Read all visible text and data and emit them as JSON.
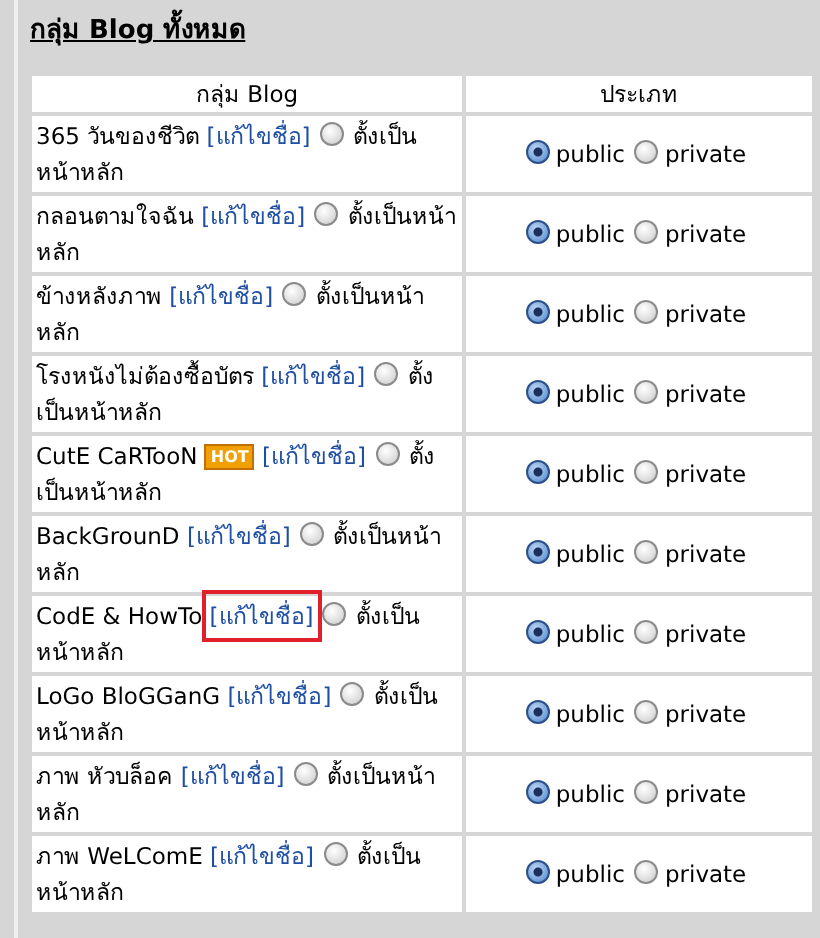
{
  "title": "กลุ่ม Blog ทั้งหมด",
  "table": {
    "columns": [
      "กลุ่ม Blog",
      "ประเภท"
    ],
    "rows": [
      {
        "name": "365 วันของชีวิต",
        "edit_link": "[แก้ไขชื่อ]",
        "highlighted": false,
        "set_main": {
          "label": "ตั้งเป็นหน้าหลัก",
          "checked": false
        },
        "visibility": [
          {
            "label": "public",
            "selected": true
          },
          {
            "label": "private",
            "selected": false
          }
        ]
      },
      {
        "name": "กลอนตามใจฉัน",
        "edit_link": "[แก้ไขชื่อ]",
        "highlighted": false,
        "set_main": {
          "label": "ตั้งเป็นหน้าหลัก",
          "checked": false
        },
        "visibility": [
          {
            "label": "public",
            "selected": true
          },
          {
            "label": "private",
            "selected": false
          }
        ]
      },
      {
        "name": "ข้างหลังภาพ",
        "edit_link": "[แก้ไขชื่อ]",
        "highlighted": false,
        "set_main": {
          "label": "ตั้งเป็นหน้าหลัก",
          "checked": false
        },
        "visibility": [
          {
            "label": "public",
            "selected": true
          },
          {
            "label": "private",
            "selected": false
          }
        ]
      },
      {
        "name": "โรงหนังไม่ต้องซื้อบัตร",
        "edit_link": "[แก้ไขชื่อ]",
        "highlighted": false,
        "set_main": {
          "label": "ตั้งเป็นหน้าหลัก",
          "checked": false
        },
        "visibility": [
          {
            "label": "public",
            "selected": true
          },
          {
            "label": "private",
            "selected": false
          }
        ]
      },
      {
        "name": "CutE CaRTooN",
        "badge": "HOT",
        "edit_link": "[แก้ไขชื่อ]",
        "highlighted": false,
        "set_main": {
          "label": "ตั้งเป็นหน้าหลัก",
          "checked": false
        },
        "visibility": [
          {
            "label": "public",
            "selected": true
          },
          {
            "label": "private",
            "selected": false
          }
        ]
      },
      {
        "name": "BackGrounD",
        "edit_link": "[แก้ไขชื่อ]",
        "highlighted": false,
        "set_main": {
          "label": "ตั้งเป็นหน้าหลัก",
          "checked": false
        },
        "visibility": [
          {
            "label": "public",
            "selected": true
          },
          {
            "label": "private",
            "selected": false
          }
        ]
      },
      {
        "name": "CodE & HowTo",
        "edit_link": "[แก้ไขชื่อ]",
        "highlighted": true,
        "set_main": {
          "label": "ตั้งเป็นหน้าหลัก",
          "checked": false
        },
        "visibility": [
          {
            "label": "public",
            "selected": true
          },
          {
            "label": "private",
            "selected": false
          }
        ]
      },
      {
        "name": "LoGo BloGGanG",
        "edit_link": "[แก้ไขชื่อ]",
        "highlighted": false,
        "set_main": {
          "label": "ตั้งเป็นหน้าหลัก",
          "checked": false
        },
        "visibility": [
          {
            "label": "public",
            "selected": true
          },
          {
            "label": "private",
            "selected": false
          }
        ]
      },
      {
        "name": "ภาพ หัวบล็อค",
        "edit_link": "[แก้ไขชื่อ]",
        "highlighted": false,
        "set_main": {
          "label": "ตั้งเป็นหน้าหลัก",
          "checked": false
        },
        "visibility": [
          {
            "label": "public",
            "selected": true
          },
          {
            "label": "private",
            "selected": false
          }
        ]
      },
      {
        "name": "ภาพ WeLComE",
        "edit_link": "[แก้ไขชื่อ]",
        "highlighted": false,
        "set_main": {
          "label": "ตั้งเป็นหน้าหลัก",
          "checked": false
        },
        "visibility": [
          {
            "label": "public",
            "selected": true
          },
          {
            "label": "private",
            "selected": false
          }
        ]
      }
    ]
  }
}
